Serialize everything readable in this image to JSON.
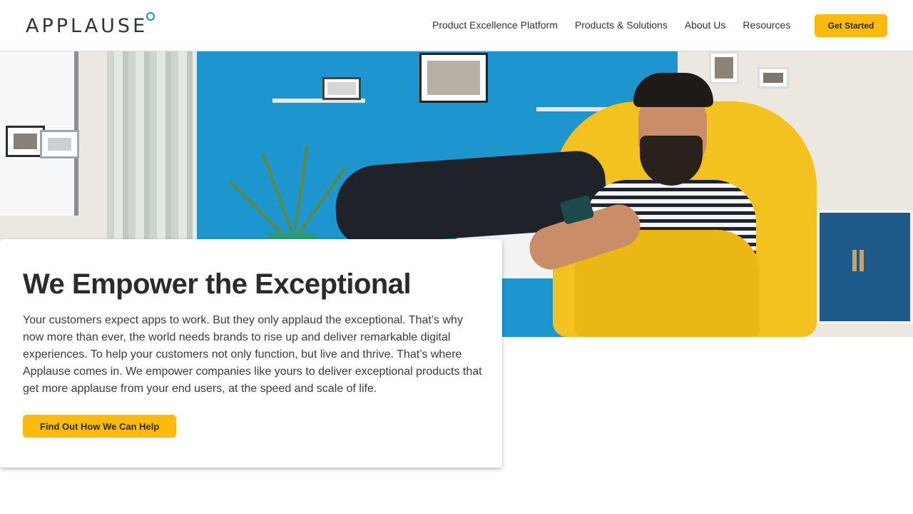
{
  "brand": {
    "logo_text": "APPLAUSE",
    "accent_color": "#fbbb0e",
    "logo_dot_color": "#1a8fcf"
  },
  "nav": {
    "items": [
      {
        "label": "Product Excellence Platform"
      },
      {
        "label": "Products & Solutions"
      },
      {
        "label": "About Us"
      },
      {
        "label": "Resources"
      }
    ],
    "cta_label": "Get Started"
  },
  "hero": {
    "image_alt": "hero-photo",
    "title": "We Empower the Exceptional",
    "body": "Your customers expect apps to work. But they only applaud the exceptional. That’s why now more than ever, the world needs brands to rise up and deliver remarkable digital experiences. To help your customers not only function, but live and thrive. That’s where Applause comes in. We empower companies like yours to deliver exceptional products that get more applause from your end users, at the speed and scale of life.",
    "cta_label": "Find Out How We Can Help"
  }
}
